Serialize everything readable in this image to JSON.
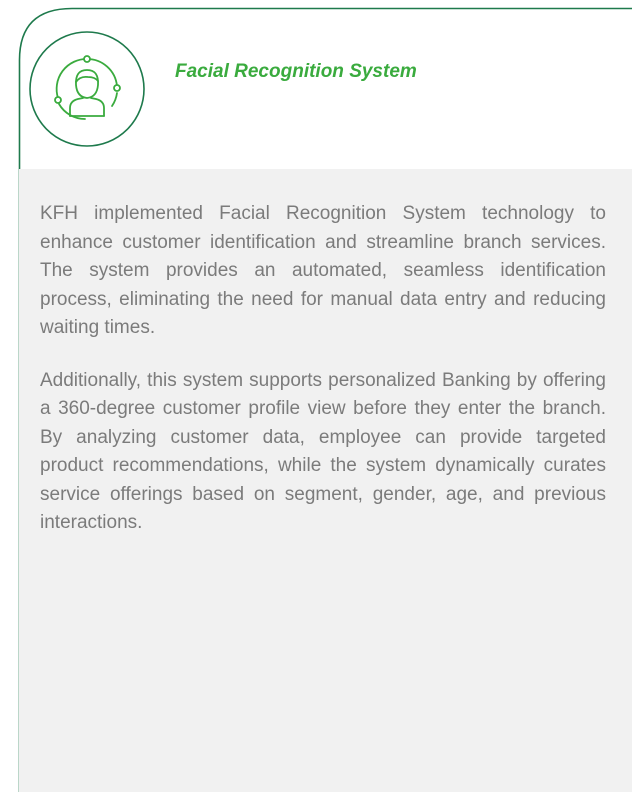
{
  "card": {
    "title": "Facial Recognition System",
    "icon": "facial-recognition-user-icon",
    "paragraphs": [
      "KFH implemented Facial Recognition System technology to enhance customer identification and streamline branch services. The system provides an automated, seamless identification process, eliminating the need for manual data entry and reducing waiting times.",
      "Additionally, this system supports personalized Banking by offering a 360-degree customer profile view before they enter the branch. By analyzing customer data, employee can provide targeted product recommendations, while the system dynamically curates service offerings based on segment, gender, age, and previous interactions."
    ]
  },
  "colors": {
    "accent": "#3aab3e",
    "frame_line": "#1e7a4c",
    "panel": "#f1f1f1",
    "text": "#7b7b7b"
  }
}
